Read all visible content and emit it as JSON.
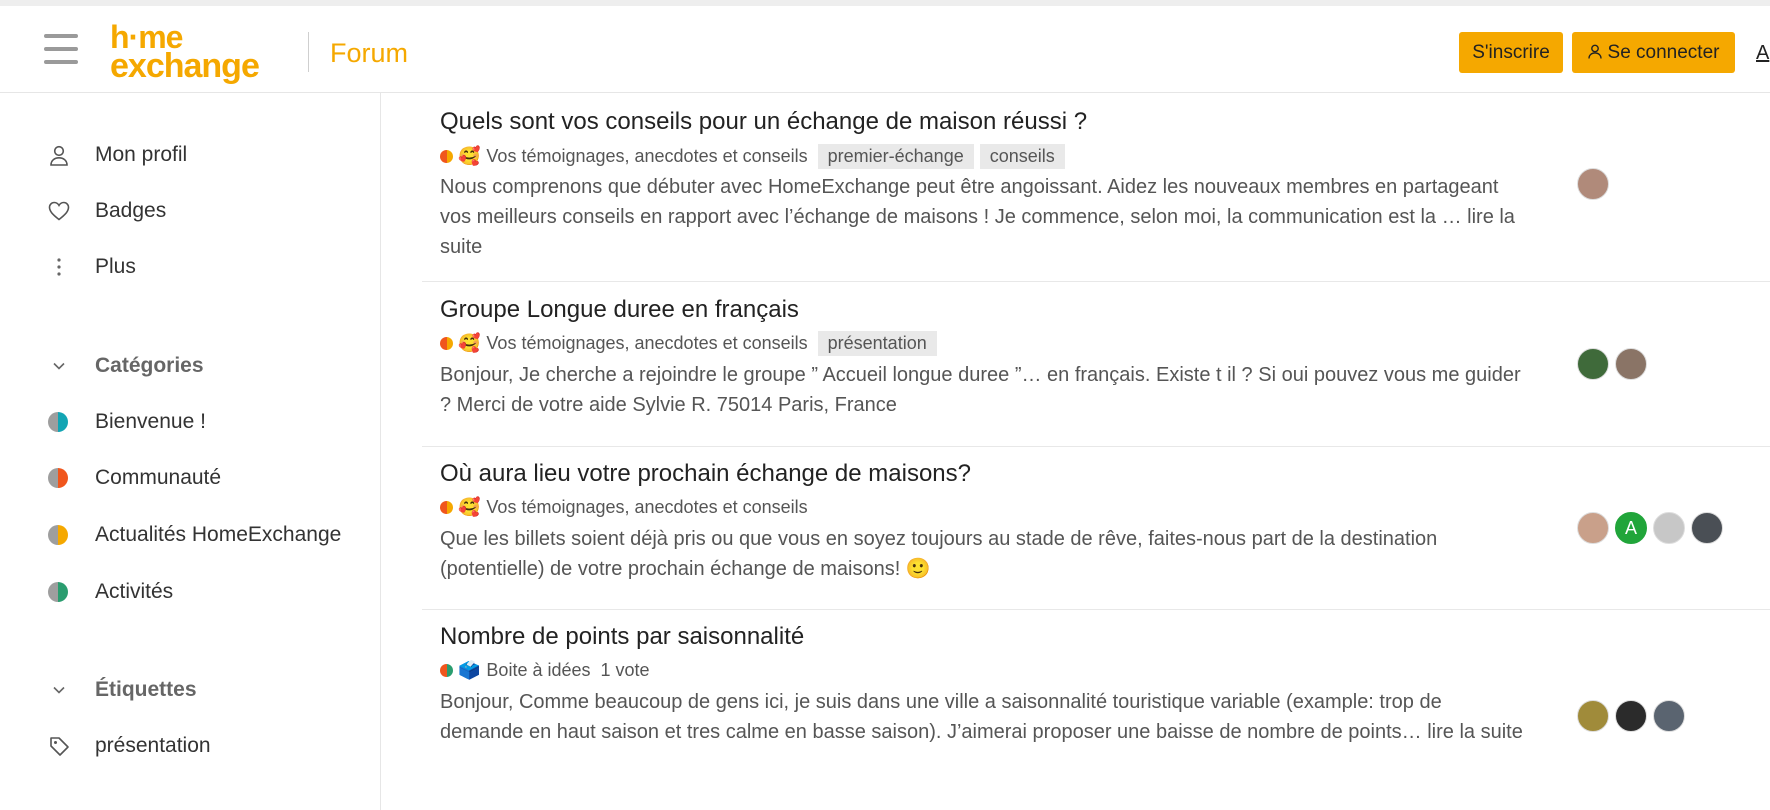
{
  "header": {
    "logo_line1": "h·me",
    "logo_line2": "exchange",
    "section": "Forum",
    "signup_label": "S'inscrire",
    "login_label": "Se connecter",
    "cut_label": "A"
  },
  "sidebar": {
    "nav": [
      {
        "label": "Mon profil",
        "icon": "user-icon"
      },
      {
        "label": "Badges",
        "icon": "heart-icon"
      },
      {
        "label": "Plus",
        "icon": "more-vertical-icon"
      }
    ],
    "categories_heading": "Catégories",
    "categories": [
      {
        "label": "Bienvenue !",
        "colors": [
          "#9e9e9e",
          "#12a5b4"
        ]
      },
      {
        "label": "Communauté",
        "colors": [
          "#9e9e9e",
          "#f0561d"
        ]
      },
      {
        "label": "Actualités HomeExchange",
        "colors": [
          "#9e9e9e",
          "#f5a800"
        ]
      },
      {
        "label": "Activités",
        "colors": [
          "#9e9e9e",
          "#2a9d6f"
        ]
      }
    ],
    "tags_heading": "Étiquettes",
    "tags": [
      {
        "label": "présentation",
        "icon": "tag-icon"
      }
    ]
  },
  "topics": [
    {
      "title": "Quels sont vos conseils pour un échange de maison réussi ?",
      "category": "Vos témoignages, anecdotes et conseils",
      "category_colors": [
        "#f0561d",
        "#f5a800"
      ],
      "emoji": "🥰",
      "tags": [
        "premier-échange",
        "conseils"
      ],
      "votes": "",
      "excerpt": "Nous comprenons que débuter avec HomeExchange peut être angoissant. Aidez les nouveaux membres en partageant vos meilleurs conseils en rapport avec l’échange de maisons ! Je commence, selon moi, la communication est la … ",
      "more": "lire la suite"
    },
    {
      "title": "Groupe Longue duree en français",
      "category": "Vos témoignages, anecdotes et conseils",
      "category_colors": [
        "#f0561d",
        "#f5a800"
      ],
      "emoji": "🥰",
      "tags": [
        "présentation"
      ],
      "votes": "",
      "excerpt": "Bonjour, Je cherche a rejoindre le groupe ” Accueil longue duree ”… en français. Existe t il ? Si oui pouvez vous me guider ? Merci de votre aide Sylvie R. 75014 Paris, France",
      "more": ""
    },
    {
      "title": "Où aura lieu votre prochain échange de maisons?",
      "category": "Vos témoignages, anecdotes et conseils",
      "category_colors": [
        "#f0561d",
        "#f5a800"
      ],
      "emoji": "🥰",
      "tags": [],
      "votes": "",
      "excerpt": "Que les billets soient déjà pris ou que vous en soyez toujours au stade de rêve, faites-nous part de la destination (potentielle) de votre prochain échange de maisons! 🙂",
      "more": ""
    },
    {
      "title": "Nombre de points par saisonnalité",
      "category": "Boite à idées",
      "category_colors": [
        "#f0561d",
        "#2a9d6f"
      ],
      "emoji": "🗳️",
      "tags": [],
      "votes": "1 vote",
      "excerpt": "Bonjour, Comme beaucoup de gens ici, je suis dans une ville a saisonnalité touristique variable (example: trop de demande en haut saison et tres calme en basse saison). J’aimerai proposer une baisse de nombre de points… ",
      "more": "lire la suite"
    }
  ],
  "avatars": [
    [
      {
        "letter": "",
        "color": "#b08a7a"
      }
    ],
    [
      {
        "letter": "",
        "color": "#3f6a3a"
      },
      {
        "letter": "",
        "color": "#8a7466"
      }
    ],
    [
      {
        "letter": "",
        "color": "#c9a08a"
      },
      {
        "letter": "A",
        "color": "#21a53a"
      },
      {
        "letter": "",
        "color": "#c7c7c7"
      },
      {
        "letter": "",
        "color": "#4a4f55"
      }
    ],
    [
      {
        "letter": "",
        "color": "#a08b3a"
      },
      {
        "letter": "",
        "color": "#2b2b2b"
      },
      {
        "letter": "",
        "color": "#5a6470"
      }
    ]
  ]
}
